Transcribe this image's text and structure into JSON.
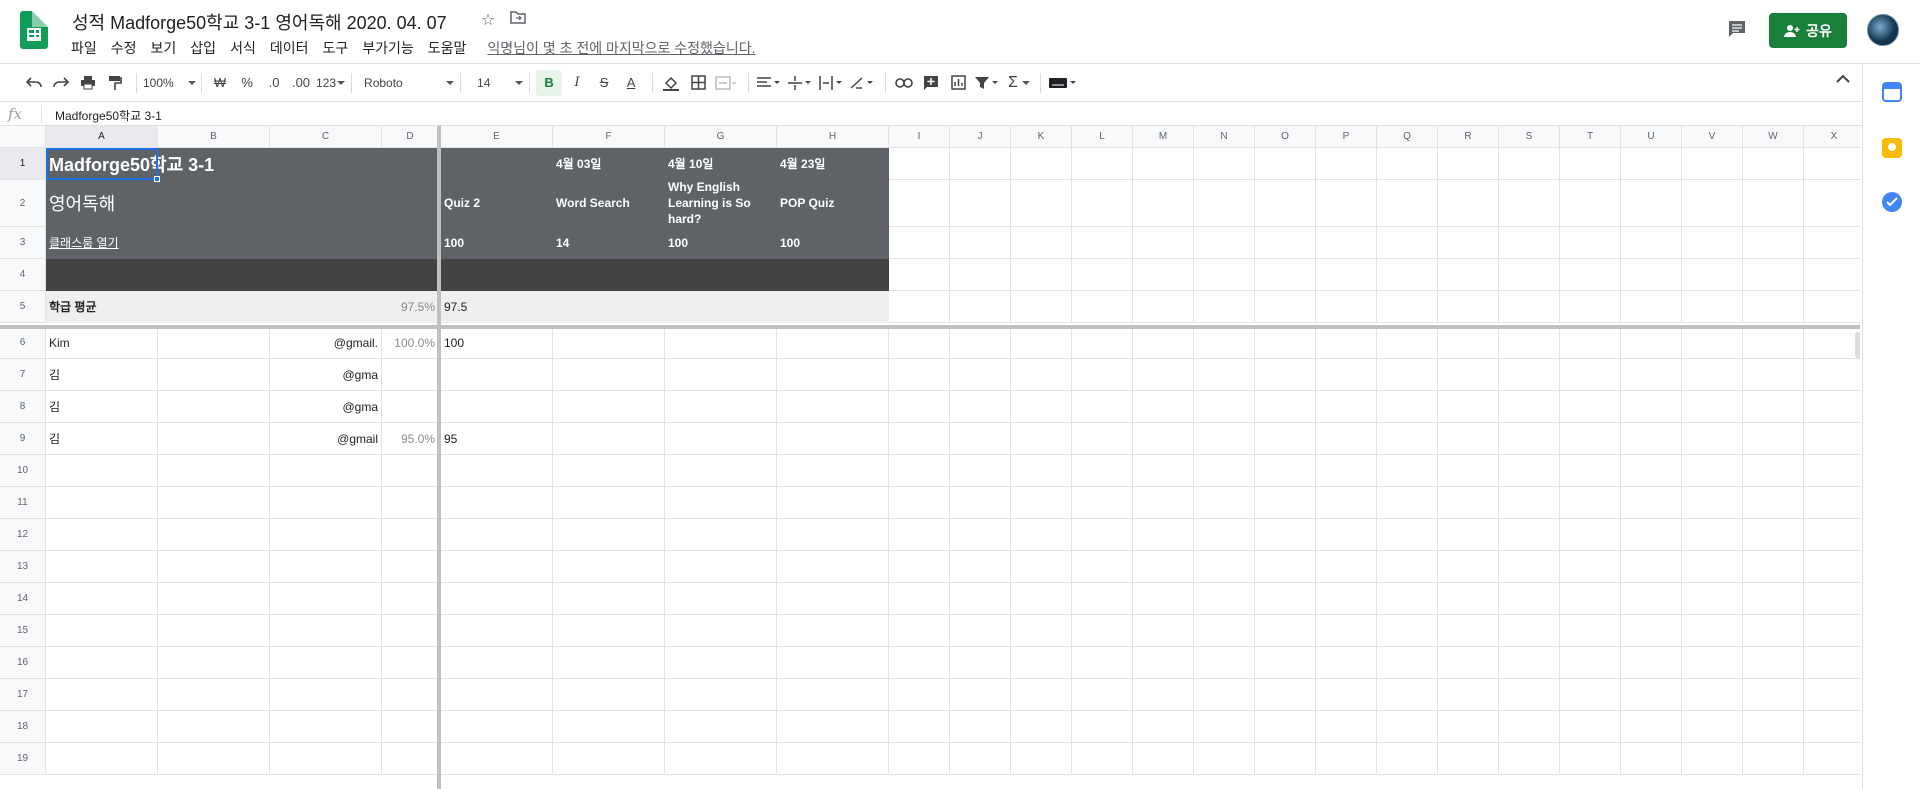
{
  "doc": {
    "title": "성적 Madforge50학교 3-1 영어독해 2020. 04. 07",
    "last_edit": "익명님이 몇 초 전에 마지막으로 수정했습니다."
  },
  "menu": [
    "파일",
    "수정",
    "보기",
    "삽입",
    "서식",
    "데이터",
    "도구",
    "부가기능",
    "도움말"
  ],
  "share_label": "공유",
  "toolbar": {
    "zoom": "100%",
    "currency": "₩",
    "percent": "%",
    "dec_decrease": ".0",
    "dec_increase": ".00",
    "more_formats": "123",
    "font": "Roboto",
    "font_size": "14",
    "bold": "B",
    "italic": "I",
    "strike": "S",
    "text_color": "A",
    "sum": "Σ"
  },
  "formula_bar": {
    "fx": "fx",
    "value": "Madforge50학교 3-1"
  },
  "columns": [
    "A",
    "B",
    "C",
    "D",
    "E",
    "F",
    "G",
    "H",
    "I",
    "J",
    "K",
    "L",
    "M",
    "N",
    "O",
    "P",
    "Q",
    "R",
    "S",
    "T",
    "U",
    "V",
    "W",
    "X"
  ],
  "rows": [
    "1",
    "2",
    "3",
    "4",
    "5",
    "6",
    "7",
    "8",
    "9",
    "10",
    "11",
    "12",
    "13",
    "14",
    "15",
    "16",
    "17",
    "18",
    "19"
  ],
  "cells": {
    "A1": "Madforge50학교 3-1",
    "A2": "영어독해",
    "A3": "클래스룸 열기",
    "A5": "학급 평균",
    "D5": "97.5%",
    "E2": "Quiz 2",
    "E3": "100",
    "E5": "97.5",
    "F1": "4월 03일",
    "F2": "Word Search",
    "F3": "14",
    "G1": "4월 10일",
    "G2": "Why English Learning is So hard?",
    "G3": "100",
    "H1": "4월 23일",
    "H2": "POP Quiz",
    "H3": "100",
    "A6": "Kim",
    "C6": "@gmail.",
    "D6": "100.0%",
    "E6": "100",
    "A7": "김",
    "C7": "@gma",
    "A8": "김",
    "C8": "@gma",
    "A9": "김",
    "C9": "@gmail",
    "D9": "95.0%",
    "E9": "95"
  },
  "colors": {
    "header_dark": "#5f6368",
    "band_dark": "#434343",
    "avg_bg": "#efefef",
    "share_green": "#188038",
    "sheets_green": "#0f9d58"
  },
  "icons": [
    "sheets-logo-icon",
    "star-icon",
    "move-folder-icon",
    "comment-icon",
    "person-add-icon",
    "undo-icon",
    "redo-icon",
    "print-icon",
    "paint-format-icon",
    "fill-color-icon",
    "borders-icon",
    "merge-icon",
    "align-icon",
    "valign-icon",
    "wrap-icon",
    "rotate-icon",
    "link-icon",
    "insert-comment-icon",
    "chart-icon",
    "filter-icon",
    "keyboard-icon",
    "collapse-icon",
    "calendar-icon",
    "keep-icon",
    "tasks-icon"
  ]
}
